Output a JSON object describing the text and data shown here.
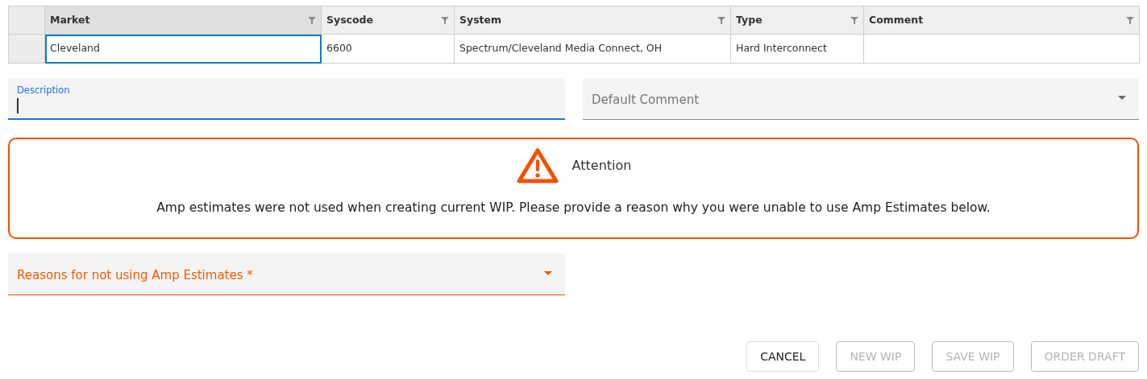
{
  "grid": {
    "columns": [
      {
        "label": "Market",
        "selected": true
      },
      {
        "label": "Syscode",
        "selected": false
      },
      {
        "label": "System",
        "selected": false
      },
      {
        "label": "Type",
        "selected": false
      },
      {
        "label": "Comment",
        "selected": false
      }
    ],
    "rows": [
      {
        "cells": [
          {
            "value": "Cleveland",
            "selected": true
          },
          {
            "value": "6600",
            "selected": false
          },
          {
            "value": "Spectrum/Cleveland Media Connect, OH",
            "selected": false
          },
          {
            "value": "Hard Interconnect",
            "selected": false
          },
          {
            "selected": false
          }
        ]
      }
    ]
  },
  "description": {
    "label": "Description",
    "focused": true
  },
  "default_comment": {
    "placeholder": "Default Comment"
  },
  "alert": {
    "title": "Attention",
    "message": "Amp estimates were not used when creating current WIP. Please provide a reason why you were unable to use Amp Estimates below."
  },
  "reasons": {
    "placeholder": "Reasons for not using Amp Estimates *",
    "error": true
  },
  "buttons": [
    {
      "label": "CANCEL",
      "disabled": false
    },
    {
      "label": "NEW WIP",
      "disabled": true
    },
    {
      "label": "SAVE WIP",
      "disabled": true
    },
    {
      "label": "ORDER DRAFT",
      "disabled": true
    }
  ]
}
